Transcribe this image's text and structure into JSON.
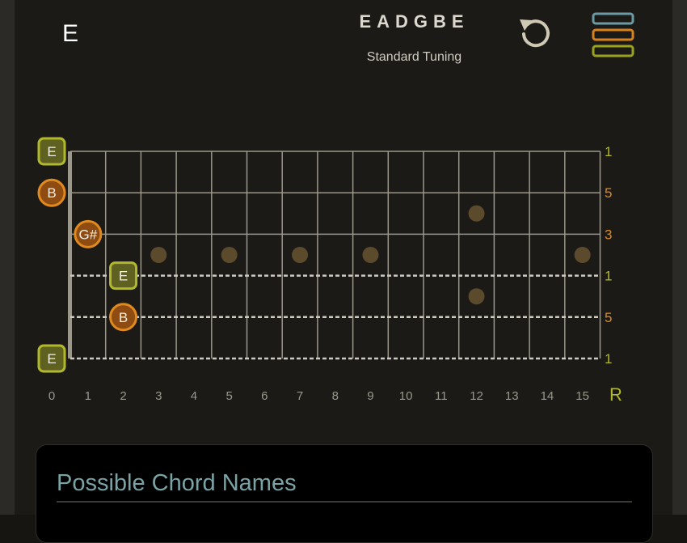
{
  "header": {
    "chord_name": "E",
    "tuning_notes": "EADGBE",
    "tuning_label": "Standard Tuning",
    "reset_icon": "undo-icon",
    "menu_icon": "menu-icon",
    "menu_colors": [
      "#6a9aa4",
      "#d8821c",
      "#9aa21e"
    ]
  },
  "fretboard": {
    "fret_numbers": [
      "0",
      "1",
      "2",
      "3",
      "4",
      "5",
      "6",
      "7",
      "8",
      "9",
      "10",
      "11",
      "12",
      "13",
      "14",
      "15"
    ],
    "root_label": "R",
    "strings": [
      {
        "name": "string-1",
        "interval": "1",
        "muted": false
      },
      {
        "name": "string-2",
        "interval": "5",
        "muted": false
      },
      {
        "name": "string-3",
        "interval": "3",
        "muted": false
      },
      {
        "name": "string-4",
        "interval": "1",
        "muted": true
      },
      {
        "name": "string-5",
        "interval": "5",
        "muted": true
      },
      {
        "name": "string-6",
        "interval": "1",
        "muted": true
      }
    ],
    "inlays": [
      {
        "fret": 3,
        "gap": 3
      },
      {
        "fret": 5,
        "gap": 3
      },
      {
        "fret": 7,
        "gap": 3
      },
      {
        "fret": 9,
        "gap": 3
      },
      {
        "fret": 15,
        "gap": 3
      },
      {
        "fret": 12,
        "gap": 2
      },
      {
        "fret": 12,
        "gap": 4
      }
    ],
    "notes": [
      {
        "string": 1,
        "fret": 0,
        "label": "E",
        "kind": "root"
      },
      {
        "string": 2,
        "fret": 0,
        "label": "B",
        "kind": "fifth"
      },
      {
        "string": 3,
        "fret": 1,
        "label": "G#",
        "kind": "third"
      },
      {
        "string": 4,
        "fret": 2,
        "label": "E",
        "kind": "root"
      },
      {
        "string": 5,
        "fret": 2,
        "label": "B",
        "kind": "fifth"
      },
      {
        "string": 6,
        "fret": 0,
        "label": "E",
        "kind": "root"
      }
    ],
    "colors": {
      "root": "#b1b82b",
      "root_fill": "#5e6120",
      "fifth": "#e08a1e",
      "fifth_fill": "#8e4b12",
      "third": "#e08a1e",
      "third_fill": "#8e4b12",
      "fret_line": "#9b978b",
      "inlay": "#5c4a2c",
      "fret_number": "#9b978b",
      "root_text": "#b1b82b"
    }
  },
  "panel": {
    "title": "Possible Chord Names"
  }
}
